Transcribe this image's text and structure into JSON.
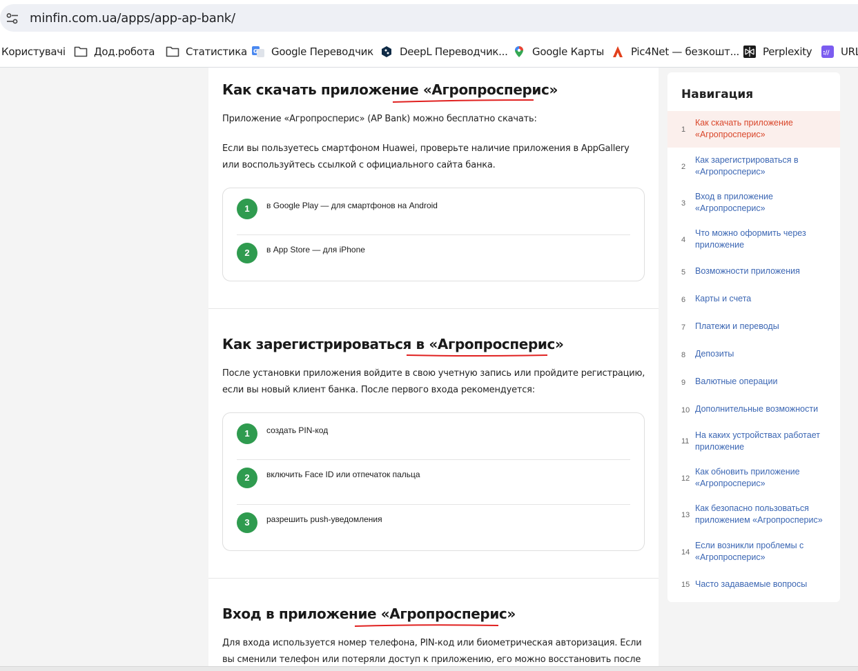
{
  "browser": {
    "url": "minfin.com.ua/apps/app-ap-bank/",
    "bookmarks": [
      {
        "label": "Користувачі",
        "icon": "none"
      },
      {
        "label": "Дод.робота",
        "icon": "folder-icon"
      },
      {
        "label": "Статистика",
        "icon": "folder-icon"
      },
      {
        "label": "Google Переводчик",
        "icon": "google-translate-icon"
      },
      {
        "label": "DeepL Переводчик...",
        "icon": "deepl-icon"
      },
      {
        "label": "Google Карты",
        "icon": "google-maps-icon"
      },
      {
        "label": "Pic4Net — безкошт...",
        "icon": "pic4net-icon"
      },
      {
        "label": "Perplexity",
        "icon": "perplexity-icon"
      },
      {
        "label": "URL",
        "icon": "url-icon"
      }
    ]
  },
  "sections": [
    {
      "title": "Как скачать приложение «Агропросперис»",
      "paragraphs": [
        "Приложение «Агропросперис» (AP Bank) можно бесплатно скачать:",
        "Если вы пользуетесь смартфоном Huawei, проверьте наличие приложения в AppGallery или воспользуйтесь ссылкой с официального сайта банка."
      ],
      "steps": [
        {
          "num": "1",
          "text": "в Google Play — для смартфонов на Android"
        },
        {
          "num": "2",
          "text": "в App Store — для iPhone"
        }
      ]
    },
    {
      "title": "Как зарегистрироваться в «Агропросперис»",
      "paragraphs": [
        "После установки приложения войдите в свою учетную запись или пройдите регистрацию, если вы новый клиент банка. После первого входа рекомендуется:"
      ],
      "steps": [
        {
          "num": "1",
          "text": "создать PIN-код"
        },
        {
          "num": "2",
          "text": "включить Face ID или отпечаток пальца"
        },
        {
          "num": "3",
          "text": "разрешить push-уведомления"
        }
      ]
    },
    {
      "title": "Вход в приложение «Агропросперис»",
      "paragraphs": [
        "Для входа используется номер телефона, PIN-код или биометрическая авторизация. Если вы сменили телефон или потеряли доступ к приложению, его можно восстановить после"
      ]
    }
  ],
  "navigation": {
    "title": "Навигация",
    "items": [
      {
        "num": "1",
        "label": "Как скачать приложение «Агропросперис»",
        "active": true
      },
      {
        "num": "2",
        "label": "Как зарегистрироваться в «Агропросперис»"
      },
      {
        "num": "3",
        "label": "Вход в приложение «Агропросперис»"
      },
      {
        "num": "4",
        "label": "Что можно оформить через приложение"
      },
      {
        "num": "5",
        "label": "Возможности приложения"
      },
      {
        "num": "6",
        "label": "Карты и счета"
      },
      {
        "num": "7",
        "label": "Платежи и переводы"
      },
      {
        "num": "8",
        "label": "Депозиты"
      },
      {
        "num": "9",
        "label": "Валютные операции"
      },
      {
        "num": "10",
        "label": "Дополнительные возможности"
      },
      {
        "num": "11",
        "label": "На каких устройствах работает приложение"
      },
      {
        "num": "12",
        "label": "Как обновить приложение «Агропросперис»"
      },
      {
        "num": "13",
        "label": "Как безопасно пользоваться приложением «Агропросперис»"
      },
      {
        "num": "14",
        "label": "Если возникли проблемы с «Агропросперис»"
      },
      {
        "num": "15",
        "label": "Часто задаваемые вопросы"
      }
    ]
  },
  "colors": {
    "accent_red": "#d9462a",
    "step_green": "#2f9b4f",
    "nav_link": "#3b66b3",
    "annotation_underline": "#e0201f"
  }
}
